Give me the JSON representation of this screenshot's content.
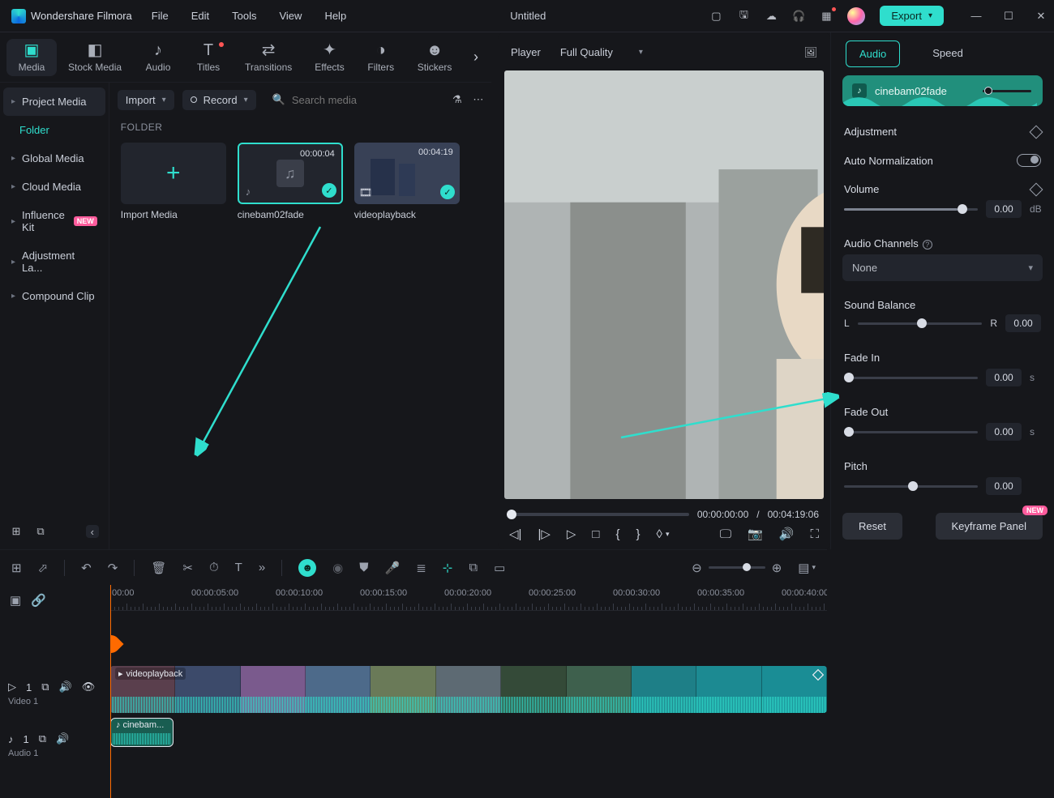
{
  "titlebar": {
    "app": "Wondershare Filmora",
    "menu": [
      "File",
      "Edit",
      "Tools",
      "View",
      "Help"
    ],
    "doc": "Untitled",
    "export": "Export"
  },
  "tabs": [
    "Media",
    "Stock Media",
    "Audio",
    "Titles",
    "Transitions",
    "Effects",
    "Filters",
    "Stickers"
  ],
  "sidebar": {
    "items": [
      "Project Media",
      "Global Media",
      "Cloud Media",
      "Influence Kit",
      "Adjustment La...",
      "Compound Clip"
    ],
    "sub": "Folder"
  },
  "media": {
    "import": "Import",
    "record": "Record",
    "search_placeholder": "Search media",
    "folder_label": "FOLDER",
    "thumbs": [
      {
        "kind": "import",
        "label": "Import Media"
      },
      {
        "kind": "audio",
        "dur": "00:00:04",
        "label": "cinebam02fade",
        "selected": true
      },
      {
        "kind": "video",
        "dur": "00:04:19",
        "label": "videoplayback"
      }
    ]
  },
  "player": {
    "title": "Player",
    "quality": "Full Quality",
    "cur": "00:00:00:00",
    "sep": "/",
    "total": "00:04:19:06"
  },
  "right": {
    "tabs": [
      "Audio",
      "Speed"
    ],
    "clip_name": "cinebam02fade",
    "adjustment": "Adjustment",
    "auto_norm": "Auto Normalization",
    "volume": "Volume",
    "vol_val": "0.00",
    "vol_unit": "dB",
    "audio_channels": "Audio Channels",
    "channels_val": "None",
    "sound_balance": "Sound Balance",
    "L": "L",
    "R": "R",
    "balance_val": "0.00",
    "fade_in": "Fade In",
    "fade_in_val": "0.00",
    "fade_out": "Fade Out",
    "fade_out_val": "0.00",
    "s": "s",
    "pitch": "Pitch",
    "pitch_val": "0.00",
    "reset": "Reset",
    "keyframe": "Keyframe Panel",
    "new": "NEW"
  },
  "ruler": [
    "00:00",
    "00:00:05:00",
    "00:00:10:00",
    "00:00:15:00",
    "00:00:20:00",
    "00:00:25:00",
    "00:00:30:00",
    "00:00:35:00",
    "00:00:40:00"
  ],
  "tracks": {
    "video": {
      "num": "1",
      "name": "Video 1",
      "clip_label": "videoplayback"
    },
    "audio": {
      "num": "1",
      "name": "Audio 1",
      "clip_label": "cinebam..."
    }
  }
}
